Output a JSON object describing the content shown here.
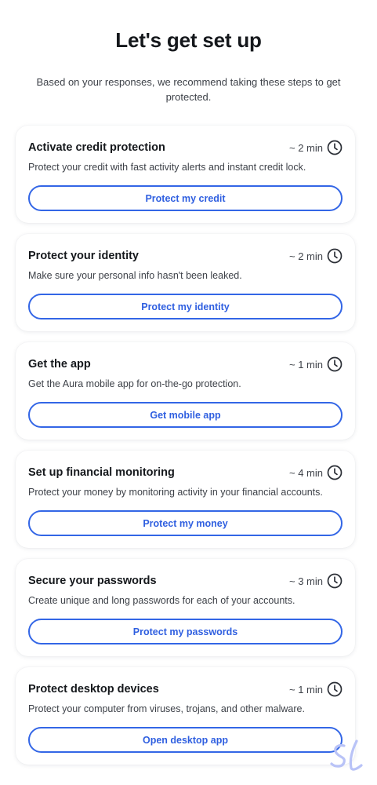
{
  "page": {
    "title": "Let's get set up",
    "subtitle": "Based on your responses, we recommend taking these steps to get protected."
  },
  "steps": [
    {
      "title": "Activate credit protection",
      "time": "~ 2 min",
      "description": "Protect your credit with fast activity alerts and instant credit lock.",
      "button": "Protect my credit"
    },
    {
      "title": "Protect your identity",
      "time": "~ 2 min",
      "description": "Make sure your personal info hasn't been leaked.",
      "button": "Protect my identity"
    },
    {
      "title": "Get the app",
      "time": "~ 1 min",
      "description": "Get the Aura mobile app for on-the-go protection.",
      "button": "Get mobile app"
    },
    {
      "title": "Set up financial monitoring",
      "time": "~ 4 min",
      "description": "Protect your money by monitoring activity in your financial accounts.",
      "button": "Protect my money"
    },
    {
      "title": "Secure your passwords",
      "time": "~ 3 min",
      "description": "Create unique and long passwords for each of your accounts.",
      "button": "Protect my passwords"
    },
    {
      "title": "Protect desktop devices",
      "time": "~ 1 min",
      "description": "Protect your computer from viruses, trojans, and other malware.",
      "button": "Open desktop app"
    }
  ],
  "icons": {
    "time": "clock-icon",
    "watermark": "sl-watermark-logo"
  },
  "colors": {
    "accent": "#3366e6",
    "watermark": "#b9c3f7"
  }
}
